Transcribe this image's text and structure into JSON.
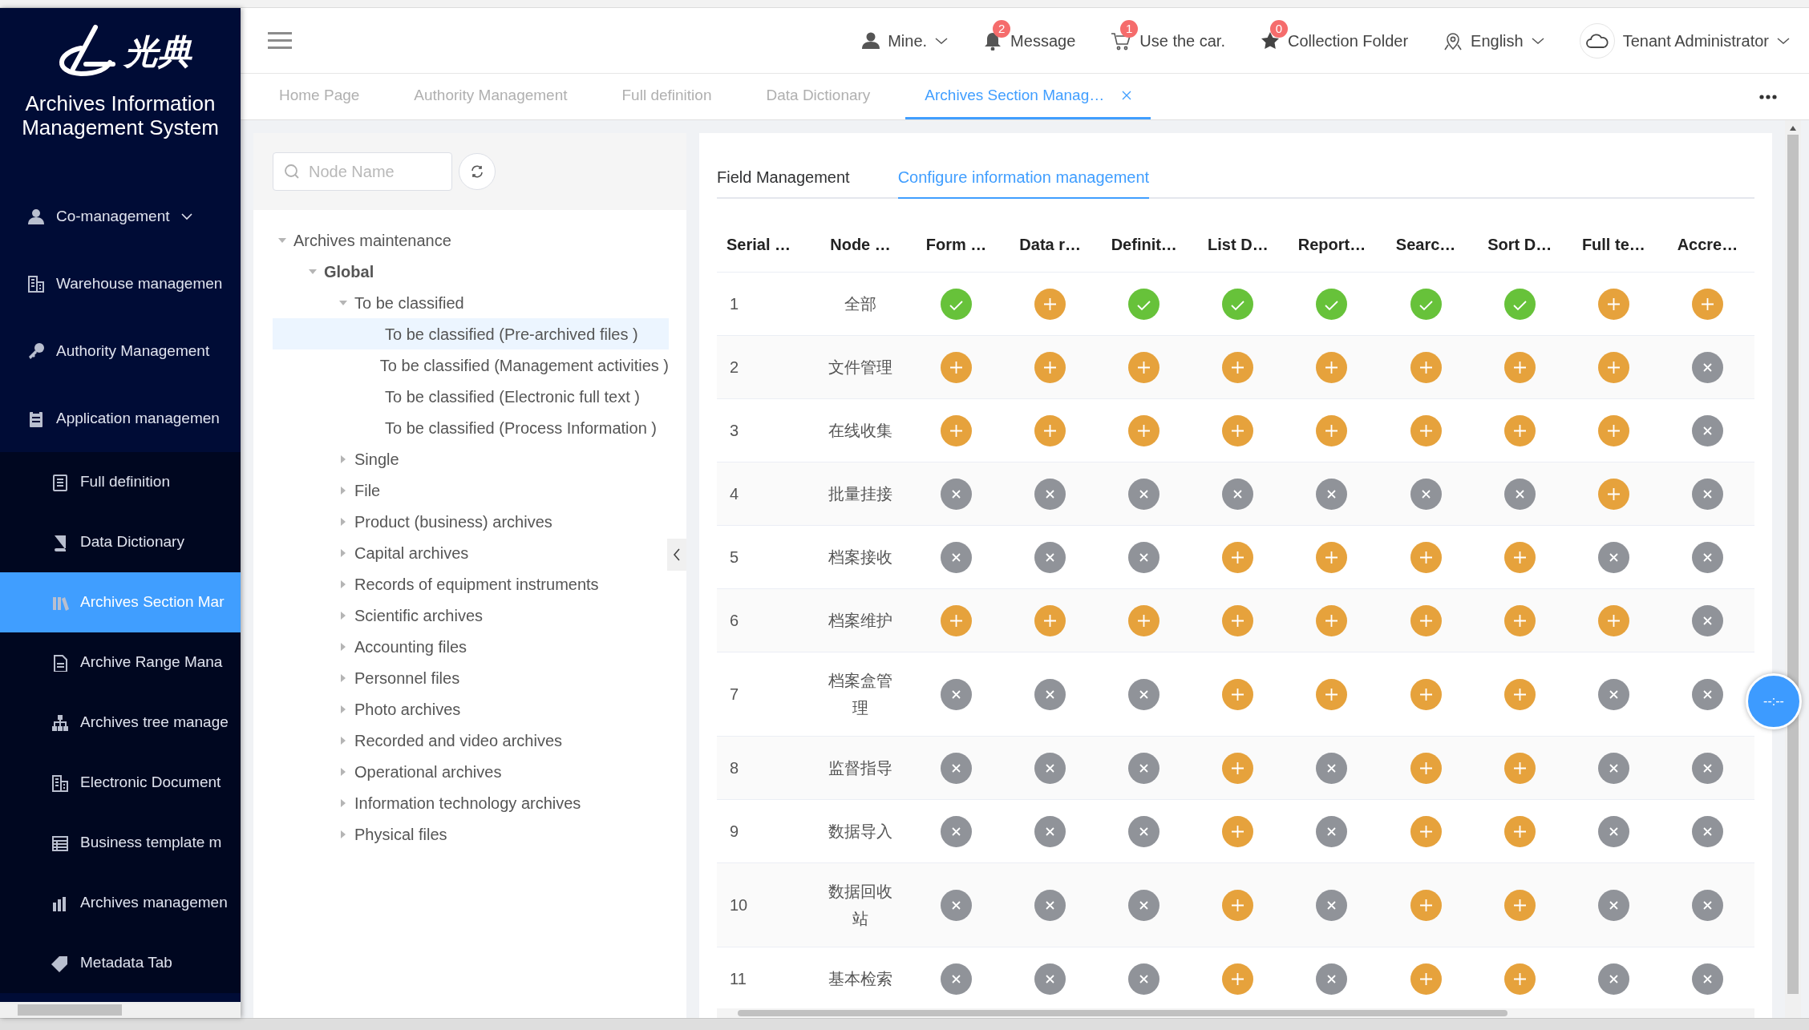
{
  "sidebar": {
    "logo_text": "光典",
    "app_title": "Archives Information Management System",
    "items": [
      {
        "label": "Co-management",
        "kind": "group"
      },
      {
        "label": "Warehouse managemen",
        "kind": "group"
      },
      {
        "label": "Authority Management",
        "kind": "group"
      },
      {
        "label": "Application managemen",
        "kind": "group"
      },
      {
        "label": "Full definition",
        "kind": "sub",
        "selected": false
      },
      {
        "label": "Data Dictionary",
        "kind": "sub",
        "selected": false
      },
      {
        "label": "Archives Section Mar",
        "kind": "sub",
        "selected": true
      },
      {
        "label": "Archive Range Mana",
        "kind": "sub",
        "selected": false
      },
      {
        "label": "Archives tree manage",
        "kind": "sub",
        "selected": false
      },
      {
        "label": "Electronic Document",
        "kind": "sub",
        "selected": false
      },
      {
        "label": "Business template m",
        "kind": "sub",
        "selected": false
      },
      {
        "label": "Archives managemen",
        "kind": "sub",
        "selected": false
      },
      {
        "label": "Metadata Tab",
        "kind": "sub",
        "selected": false
      }
    ]
  },
  "header": {
    "items": [
      {
        "label": "Mine.",
        "dropdown": true
      },
      {
        "label": "Message",
        "badge": "2"
      },
      {
        "label": "Use the car.",
        "badge": "1"
      },
      {
        "label": "Collection Folder",
        "badge": "0"
      },
      {
        "label": "English",
        "dropdown": true
      },
      {
        "label": "Tenant Administrator",
        "dropdown": true
      }
    ]
  },
  "tabs": [
    {
      "label": "Home Page",
      "selected": false
    },
    {
      "label": "Authority Management",
      "selected": false
    },
    {
      "label": "Full definition",
      "selected": false
    },
    {
      "label": "Data Dictionary",
      "selected": false
    },
    {
      "label": "Archives Section Manag…",
      "selected": true,
      "closable": true
    }
  ],
  "tree_panel": {
    "search": {
      "placeholder": "Node Name"
    },
    "tree": [
      {
        "label": "Archives maintenance",
        "expanded": true,
        "children": [
          {
            "label": "Global",
            "expanded": true,
            "bold": true,
            "children": [
              {
                "label": "To be classified",
                "expanded": true,
                "children": [
                  {
                    "label": "To be classified (Pre-archived files )",
                    "selected": true
                  },
                  {
                    "label": "To be classified (Management activities )",
                    "selected": false
                  },
                  {
                    "label": "To be classified (Electronic full text )",
                    "selected": false
                  },
                  {
                    "label": "To be classified (Process Information )",
                    "selected": false
                  }
                ]
              },
              {
                "label": "Single",
                "expanded": false
              },
              {
                "label": "File",
                "expanded": false
              },
              {
                "label": "Product (business) archives",
                "expanded": false
              },
              {
                "label": "Capital archives",
                "expanded": false
              },
              {
                "label": "Records of equipment instruments",
                "expanded": false
              },
              {
                "label": "Scientific archives",
                "expanded": false
              },
              {
                "label": "Accounting files",
                "expanded": false
              },
              {
                "label": "Personnel files",
                "expanded": false
              },
              {
                "label": "Photo archives",
                "expanded": false
              },
              {
                "label": "Recorded and video archives",
                "expanded": false
              },
              {
                "label": "Operational archives",
                "expanded": false
              },
              {
                "label": "Information technology archives",
                "expanded": false
              },
              {
                "label": "Physical files",
                "expanded": false
              }
            ]
          }
        ]
      }
    ]
  },
  "content_tabs": [
    {
      "label": "Field Management",
      "selected": false
    },
    {
      "label": "Configure information management",
      "selected": true
    }
  ],
  "table": {
    "columns": [
      "Serial …",
      "Node …",
      "Form …",
      "Data r…",
      "Definit…",
      "List D…",
      "Report…",
      "Searc…",
      "Sort D…",
      "Full te…",
      "Accre…"
    ],
    "rows": [
      {
        "serial": "1",
        "node": "全部",
        "cells": [
          {
            "kind": "check"
          },
          {
            "kind": "plus"
          },
          {
            "kind": "check"
          },
          {
            "kind": "check"
          },
          {
            "kind": "check"
          },
          {
            "kind": "check"
          },
          {
            "kind": "check"
          },
          {
            "kind": "plus"
          },
          {
            "kind": "plus"
          }
        ]
      },
      {
        "serial": "2",
        "node": "文件管理",
        "cells": [
          {
            "kind": "plus"
          },
          {
            "kind": "plus"
          },
          {
            "kind": "plus"
          },
          {
            "kind": "plus"
          },
          {
            "kind": "plus"
          },
          {
            "kind": "plus"
          },
          {
            "kind": "plus"
          },
          {
            "kind": "plus"
          },
          {
            "kind": "cross"
          }
        ]
      },
      {
        "serial": "3",
        "node": "在线收集",
        "cells": [
          {
            "kind": "plus"
          },
          {
            "kind": "plus"
          },
          {
            "kind": "plus"
          },
          {
            "kind": "plus"
          },
          {
            "kind": "plus"
          },
          {
            "kind": "plus"
          },
          {
            "kind": "plus"
          },
          {
            "kind": "plus"
          },
          {
            "kind": "cross"
          }
        ]
      },
      {
        "serial": "4",
        "node": "批量挂接",
        "cells": [
          {
            "kind": "cross"
          },
          {
            "kind": "cross"
          },
          {
            "kind": "cross"
          },
          {
            "kind": "cross"
          },
          {
            "kind": "cross"
          },
          {
            "kind": "cross"
          },
          {
            "kind": "cross"
          },
          {
            "kind": "plus"
          },
          {
            "kind": "cross"
          }
        ]
      },
      {
        "serial": "5",
        "node": "档案接收",
        "cells": [
          {
            "kind": "cross"
          },
          {
            "kind": "cross"
          },
          {
            "kind": "cross"
          },
          {
            "kind": "plus"
          },
          {
            "kind": "plus"
          },
          {
            "kind": "plus"
          },
          {
            "kind": "plus"
          },
          {
            "kind": "cross"
          },
          {
            "kind": "cross"
          }
        ]
      },
      {
        "serial": "6",
        "node": "档案维护",
        "cells": [
          {
            "kind": "plus"
          },
          {
            "kind": "plus"
          },
          {
            "kind": "plus"
          },
          {
            "kind": "plus"
          },
          {
            "kind": "plus"
          },
          {
            "kind": "plus"
          },
          {
            "kind": "plus"
          },
          {
            "kind": "plus"
          },
          {
            "kind": "cross"
          }
        ]
      },
      {
        "serial": "7",
        "node": "档案盒管理",
        "cells": [
          {
            "kind": "cross"
          },
          {
            "kind": "cross"
          },
          {
            "kind": "cross"
          },
          {
            "kind": "plus"
          },
          {
            "kind": "plus"
          },
          {
            "kind": "plus"
          },
          {
            "kind": "plus"
          },
          {
            "kind": "cross"
          },
          {
            "kind": "cross"
          }
        ]
      },
      {
        "serial": "8",
        "node": "监督指导",
        "cells": [
          {
            "kind": "cross"
          },
          {
            "kind": "cross"
          },
          {
            "kind": "cross"
          },
          {
            "kind": "plus"
          },
          {
            "kind": "cross"
          },
          {
            "kind": "plus"
          },
          {
            "kind": "plus"
          },
          {
            "kind": "cross"
          },
          {
            "kind": "cross"
          }
        ]
      },
      {
        "serial": "9",
        "node": "数据导入",
        "cells": [
          {
            "kind": "cross"
          },
          {
            "kind": "cross"
          },
          {
            "kind": "cross"
          },
          {
            "kind": "plus"
          },
          {
            "kind": "cross"
          },
          {
            "kind": "plus"
          },
          {
            "kind": "plus"
          },
          {
            "kind": "cross"
          },
          {
            "kind": "cross"
          }
        ]
      },
      {
        "serial": "10",
        "node": "数据回收站",
        "cells": [
          {
            "kind": "cross"
          },
          {
            "kind": "cross"
          },
          {
            "kind": "cross"
          },
          {
            "kind": "plus"
          },
          {
            "kind": "cross"
          },
          {
            "kind": "plus"
          },
          {
            "kind": "plus"
          },
          {
            "kind": "cross"
          },
          {
            "kind": "cross"
          }
        ]
      },
      {
        "serial": "11",
        "node": "基本检索",
        "cells": [
          {
            "kind": "cross"
          },
          {
            "kind": "cross"
          },
          {
            "kind": "cross"
          },
          {
            "kind": "plus"
          },
          {
            "kind": "cross"
          },
          {
            "kind": "plus"
          },
          {
            "kind": "plus"
          },
          {
            "kind": "cross"
          },
          {
            "kind": "cross"
          }
        ]
      }
    ]
  },
  "floating_button": {
    "label": "--:--"
  }
}
